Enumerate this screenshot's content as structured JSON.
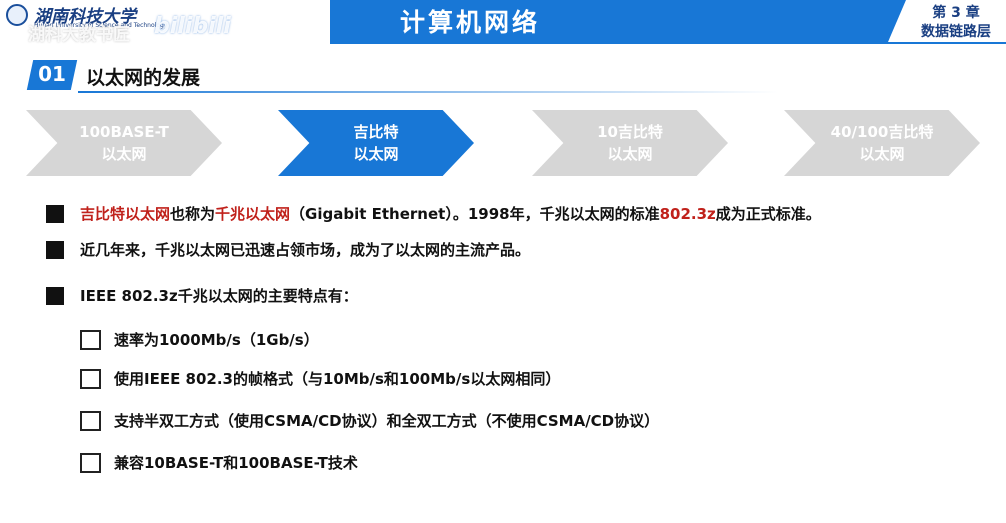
{
  "header": {
    "title": "计算机网络",
    "logo_text": "湖南科技大学",
    "logo_subtext": "Hunan University of Science and Technology",
    "chapter_line1": "第 3 章",
    "chapter_line2": "数据链路层",
    "watermark_text": "湖科大教书匠",
    "watermark_brand": "bilibili"
  },
  "section": {
    "number": "01",
    "title": "以太网的发展"
  },
  "arrows": [
    {
      "line1": "100BASE-T",
      "line2": "以太网",
      "active": false
    },
    {
      "line1": "吉比特",
      "line2": "以太网",
      "active": true
    },
    {
      "line1": "10吉比特",
      "line2": "以太网",
      "active": false
    },
    {
      "line1": "40/100吉比特",
      "line2": "以太网",
      "active": false
    }
  ],
  "bullets": {
    "b1": {
      "p1": "吉比特以太网",
      "p2": "也称为",
      "p3": "千兆以太网",
      "p4": "（Gigabit Ethernet）。1998年，千兆以太网的标准",
      "p5": "802.3z",
      "p6": "成为正式标准。"
    },
    "b2": "近几年来，千兆以太网已迅速占领市场，成为了以太网的主流产品。",
    "b3": "IEEE 802.3z千兆以太网的主要特点有："
  },
  "features": [
    "速率为1000Mb/s（1Gb/s）",
    "使用IEEE 802.3的帧格式（与10Mb/s和100Mb/s以太网相同）",
    "支持半双工方式（使用CSMA/CD协议）和全双工方式（不使用CSMA/CD协议）",
    "兼容10BASE-T和100BASE-T技术"
  ],
  "colors": {
    "accent": "#1877d6",
    "highlight": "#c0211b",
    "inactive_arrow": "#d6d6d6"
  }
}
